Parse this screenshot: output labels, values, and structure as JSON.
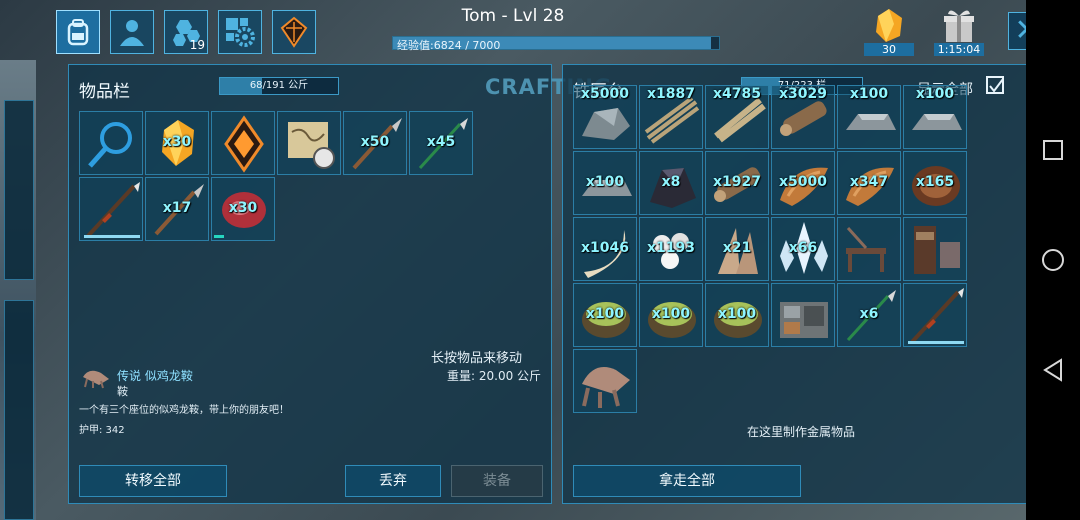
{
  "header": {
    "player_title": "Tom - Lvl 28",
    "xp_text": "经验值:6824 / 7000",
    "xp_progress": 0.975,
    "nav_icons": [
      "backpack-icon",
      "character-icon",
      "engrams-icon",
      "settings-icon",
      "tribe-icon"
    ],
    "engrams_count": "19",
    "resource_count": "30",
    "timer": "1:15:04"
  },
  "inventory": {
    "title": "物品栏",
    "weight_text": "68/191 公斤",
    "weight_fraction": 0.356,
    "crafting_label": "CRAFTING",
    "slots": [
      {
        "icon": "search-icon",
        "qty": ""
      },
      {
        "icon": "amber-icon",
        "qty": "x30"
      },
      {
        "icon": "implant-icon",
        "qty": ""
      },
      {
        "icon": "map-compass-icon",
        "qty": ""
      },
      {
        "icon": "spear-icon",
        "qty": "x50"
      },
      {
        "icon": "arrow-icon",
        "qty": "x45"
      },
      {
        "icon": "metal-pike-icon",
        "qty": ""
      },
      {
        "icon": "spear-icon",
        "qty": "x17"
      },
      {
        "icon": "raw-meat-icon",
        "qty": "x30"
      }
    ],
    "move_hint": "长按物品来移动",
    "selected_item": {
      "name": "传说 似鸡龙鞍",
      "type": "鞍",
      "description": "一个有三个座位的似鸡龙鞍，带上你的朋友吧！",
      "armor": "护甲: 342",
      "weight": "重量: 20.00 公斤"
    },
    "buttons": {
      "transfer_all": "转移全部",
      "drop": "丢弃",
      "equip": "装备"
    }
  },
  "smithy": {
    "title": "铁匠台",
    "slots_text": "71/223 栏",
    "slots_fraction": 0.318,
    "show_all": "显示全部",
    "show_all_checked": true,
    "slots": [
      {
        "icon": "ore-icon",
        "qty": "x5000"
      },
      {
        "icon": "fiber-icon",
        "qty": "x1887"
      },
      {
        "icon": "thatch-icon",
        "qty": "x4785"
      },
      {
        "icon": "wood-icon",
        "qty": "x3029"
      },
      {
        "icon": "metal-ingot-icon",
        "qty": "x100"
      },
      {
        "icon": "metal-ingot-icon",
        "qty": "x100"
      },
      {
        "icon": "metal-ingot-icon",
        "qty": "x100"
      },
      {
        "icon": "obsidian-icon",
        "qty": "x8"
      },
      {
        "icon": "wood-icon",
        "qty": "x1927"
      },
      {
        "icon": "hide-icon",
        "qty": "x5000"
      },
      {
        "icon": "hide-icon",
        "qty": "x347"
      },
      {
        "icon": "chitin-icon",
        "qty": "x165"
      },
      {
        "icon": "tusk-icon",
        "qty": "x1046"
      },
      {
        "icon": "pearl-icon",
        "qty": "x1193"
      },
      {
        "icon": "feather-icon",
        "qty": "x21"
      },
      {
        "icon": "crystal-icon",
        "qty": "x66"
      },
      {
        "icon": "furniture-icon",
        "qty": ""
      },
      {
        "icon": "bookshelf-icon",
        "qty": ""
      },
      {
        "icon": "cementing-paste-icon",
        "qty": "x100"
      },
      {
        "icon": "cementing-paste-icon",
        "qty": "x100"
      },
      {
        "icon": "cementing-paste-icon",
        "qty": "x100"
      },
      {
        "icon": "machine-icon",
        "qty": ""
      },
      {
        "icon": "arrow-icon",
        "qty": "x6"
      },
      {
        "icon": "metal-pike-icon",
        "qty": ""
      },
      {
        "icon": "saddle-icon",
        "qty": ""
      }
    ],
    "craft_hint": "在这里制作金属物品",
    "buttons": {
      "take_all": "拿走全部"
    }
  },
  "colors": {
    "accent": "#2f8bb8",
    "qty_text": "#8ff5ff",
    "panel_bg": "#123448"
  }
}
